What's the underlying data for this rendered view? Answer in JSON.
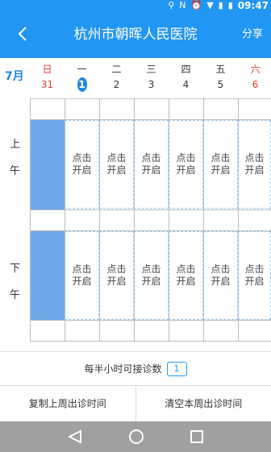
{
  "status": {
    "time": "09:47",
    "sim": "N",
    "lte": "4G"
  },
  "header": {
    "title": "杭州市朝晖人民医院",
    "share": "分享"
  },
  "week": {
    "month": "7月",
    "days": [
      {
        "wk": "日",
        "dt": "31",
        "red": true
      },
      {
        "wk": "一",
        "dt": "1",
        "selected": true
      },
      {
        "wk": "二",
        "dt": "2"
      },
      {
        "wk": "三",
        "dt": "3"
      },
      {
        "wk": "四",
        "dt": "4"
      },
      {
        "wk": "五",
        "dt": "5"
      },
      {
        "wk": "六",
        "dt": "6",
        "red": true
      }
    ]
  },
  "schedule": {
    "morning": [
      "上",
      "午"
    ],
    "afternoon": [
      "下",
      "午"
    ],
    "cell_text": [
      "点击",
      "开启"
    ],
    "active_color": "#6fa8e8"
  },
  "footer": {
    "label": "每半小时可接诊数",
    "count": "1",
    "copy_button": "复制上周出诊时间",
    "clear_button": "清空本周出诊时间"
  }
}
